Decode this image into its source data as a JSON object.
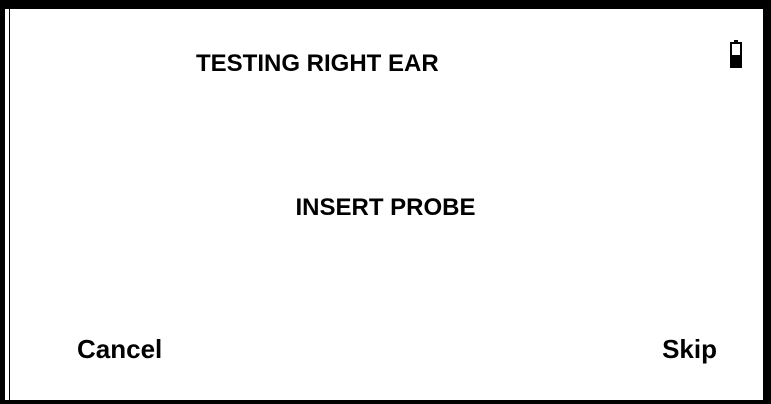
{
  "header": {
    "title": "TESTING RIGHT EAR",
    "battery_icon": "battery-low-icon"
  },
  "main": {
    "message": "INSERT PROBE"
  },
  "softkeys": {
    "left_label": "Cancel",
    "right_label": "Skip"
  }
}
